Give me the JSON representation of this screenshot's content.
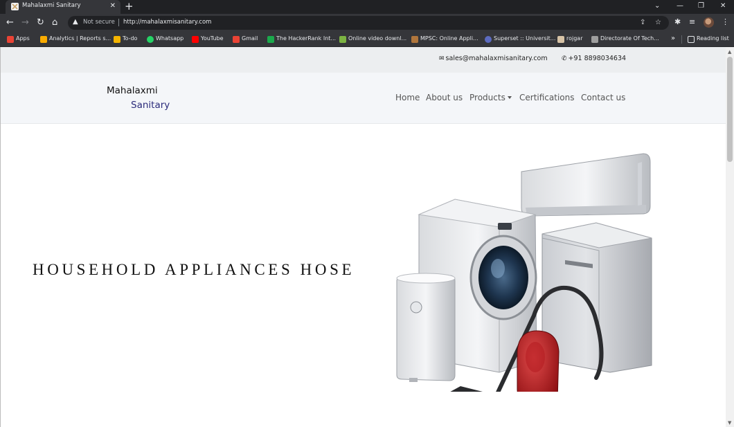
{
  "browser": {
    "tab_title": "Mahalaxmi Sanitary",
    "tab_close": "✕",
    "new_tab": "+",
    "security_label": "Not secure",
    "url": "http://mahalaxmisanitary.com",
    "window_controls": [
      "⌄",
      "—",
      "❐",
      "✕"
    ]
  },
  "bookmarks": [
    {
      "label": "Apps",
      "icon": "apps-grid-icon",
      "color": "#ea4335"
    },
    {
      "label": "Analytics | Reports s...",
      "icon": "analytics-icon",
      "color": "#f9ab00"
    },
    {
      "label": "To-do",
      "icon": "todo-icon",
      "color": "#f4b400"
    },
    {
      "label": "Whatsapp",
      "icon": "whatsapp-icon",
      "color": "#25d366"
    },
    {
      "label": "YouTube",
      "icon": "youtube-icon",
      "color": "#ff0000"
    },
    {
      "label": "Gmail",
      "icon": "gmail-icon",
      "color": "#ea4335"
    },
    {
      "label": "The HackerRank Int...",
      "icon": "hackerrank-icon",
      "color": "#1ba94c"
    },
    {
      "label": "Online video downl...",
      "icon": "download-icon",
      "color": "#7cb342"
    },
    {
      "label": "MPSC: Online Appli...",
      "icon": "mpsc-icon",
      "color": "#b0763c"
    },
    {
      "label": "Superset :: Universit...",
      "icon": "superset-icon",
      "color": "#5c6bc0"
    },
    {
      "label": "rojgar",
      "icon": "rojgar-icon",
      "color": "#d7c3a6"
    },
    {
      "label": "Directorate Of Tech...",
      "icon": "directorate-icon",
      "color": "#9e9e9e"
    }
  ],
  "bookmarks_more": "»",
  "reading_list": "Reading list",
  "site": {
    "email": "sales@mahalaxmisanitary.com",
    "phone": "+91 8898034634",
    "brand_line1": "Mahalaxmi",
    "brand_line2": "Sanitary",
    "nav": [
      "Home",
      "About us",
      "Products",
      "Certifications",
      "Contact us"
    ],
    "hero_heading": "HOUSEHOLD APPLIANCES HOSE"
  },
  "colors": {
    "chrome_dark": "#202124",
    "chrome_mid": "#35363a",
    "topbar_bg": "#eceef0",
    "navbar_bg": "#f4f6f9",
    "brand_accent": "#2a2a7a"
  }
}
